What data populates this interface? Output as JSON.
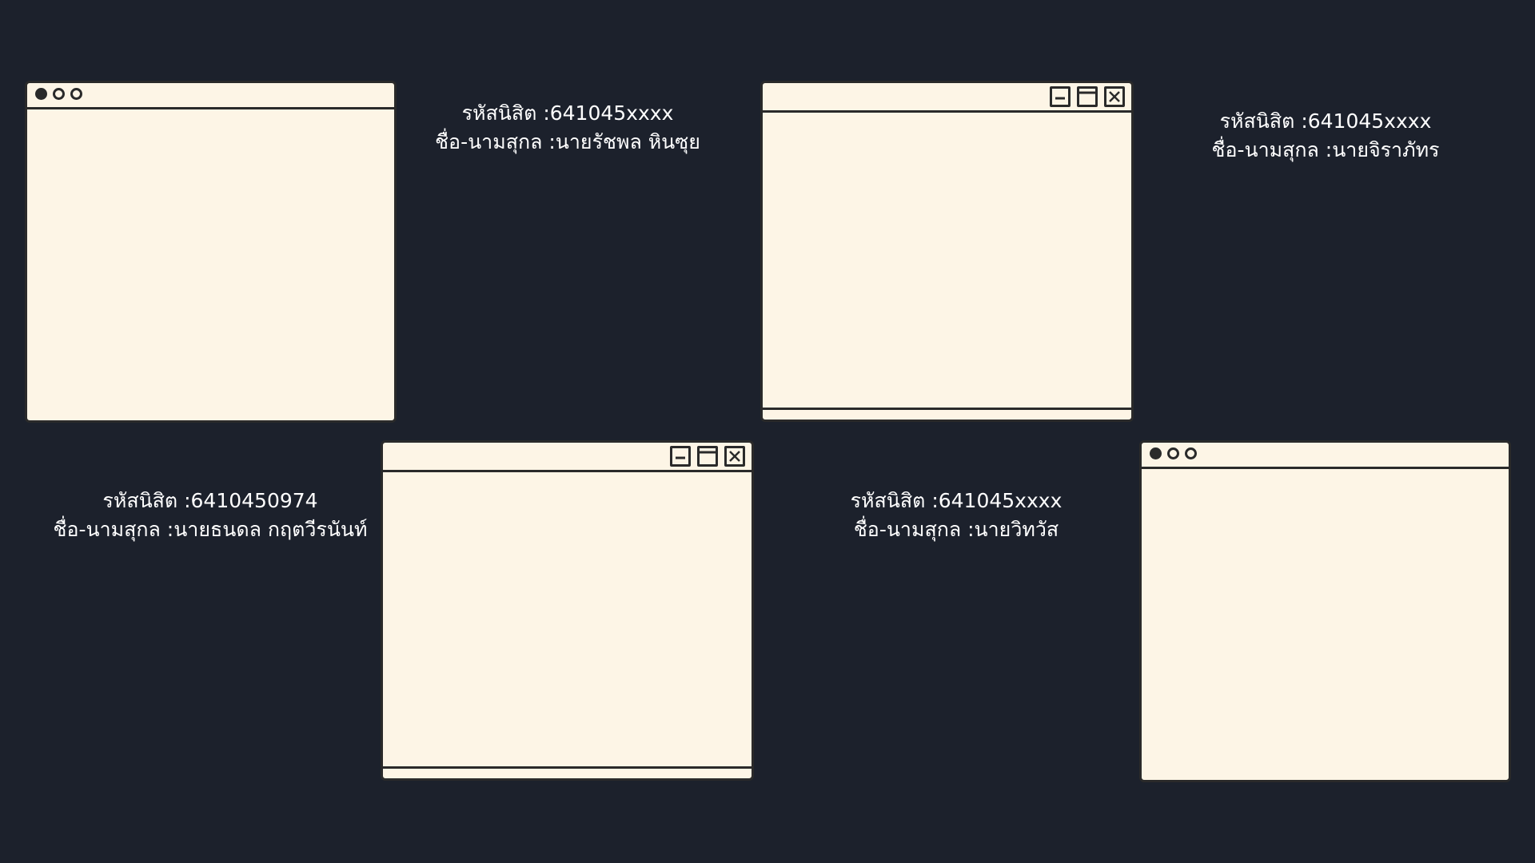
{
  "students": [
    {
      "id_line": "รหัสนิสิต :641045xxxx",
      "name_line": "ชื่อ-นามสุกล :นายรัชพล หินซุย"
    },
    {
      "id_line": "รหัสนิสิต :641045xxxx",
      "name_line": "ชื่อ-นามสุกล :นายจิราภัทร"
    },
    {
      "id_line": "รหัสนิสิต :6410450974",
      "name_line": "ชื่อ-นามสุกล :นายธนดล กฤตวีรนันท์"
    },
    {
      "id_line": "รหัสนิสิต :641045xxxx",
      "name_line": "ชื่อ-นามสุกล :นายวิทวัส"
    }
  ],
  "colors": {
    "background": "#1c212c",
    "window_fill": "#fdf5e6",
    "outline": "#2a2a2a",
    "text": "#ffffff"
  },
  "icons": [
    "traffic-light-dots",
    "minimize-icon",
    "maximize-icon",
    "close-icon"
  ]
}
